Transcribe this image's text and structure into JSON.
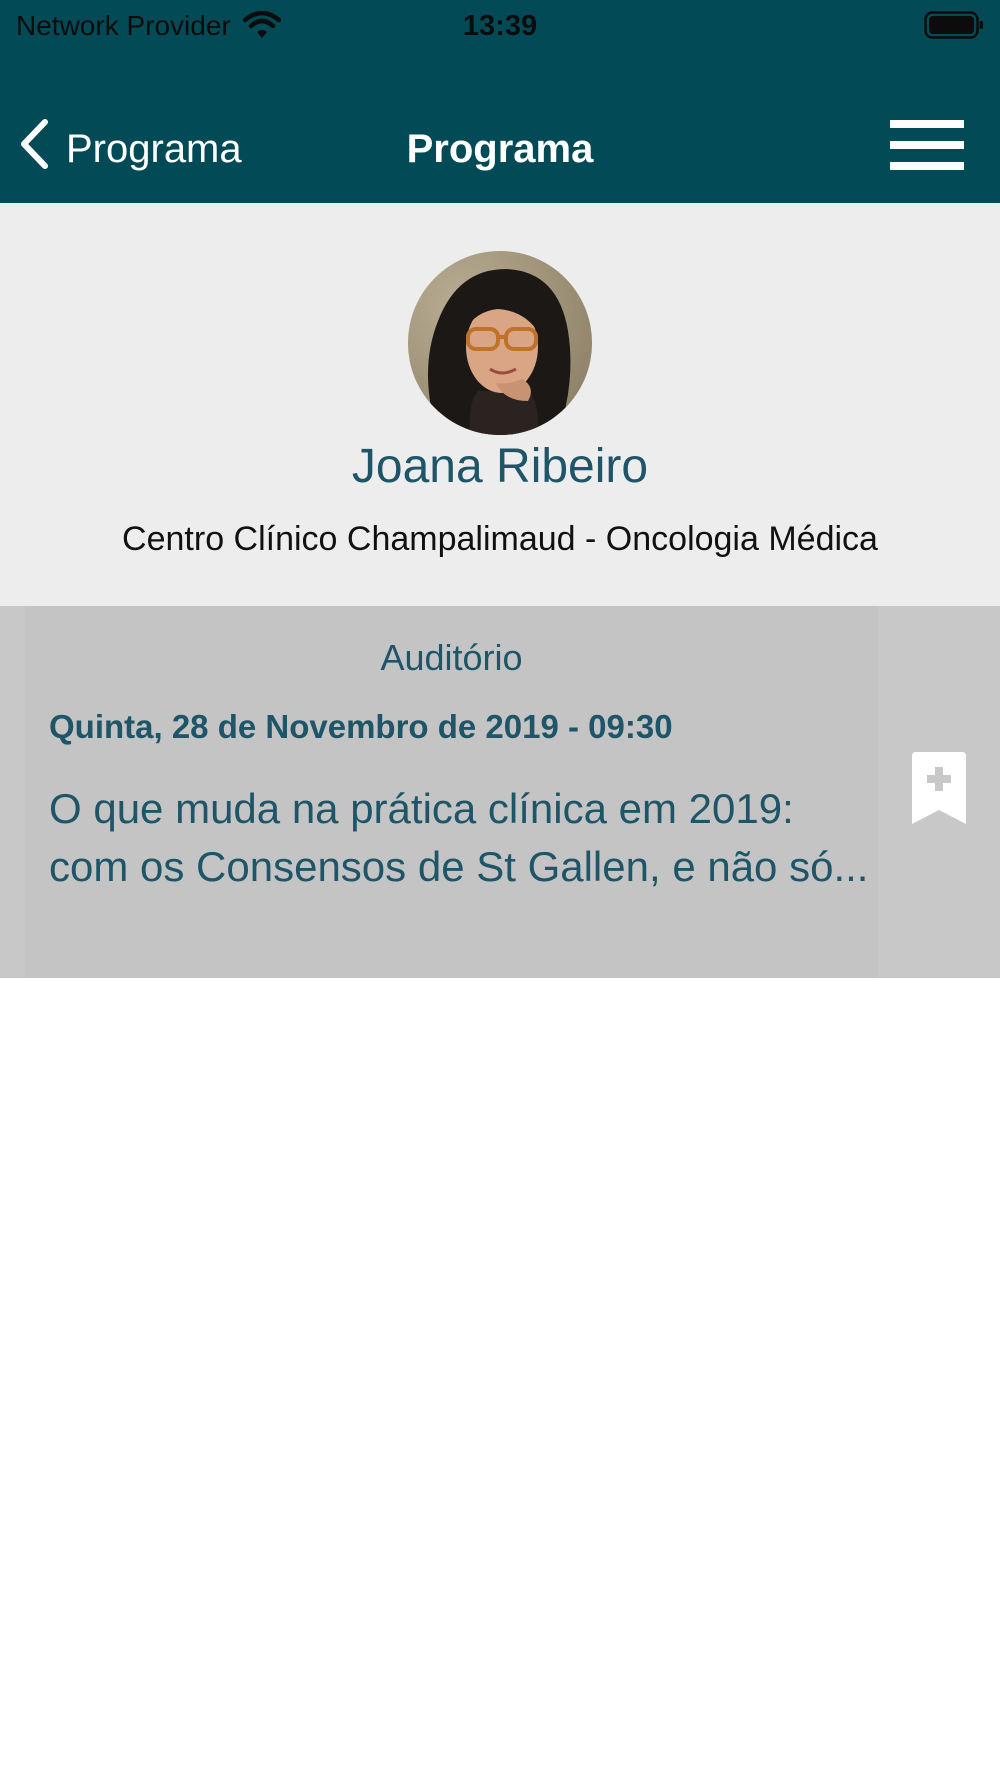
{
  "status_bar": {
    "carrier": "Network Provider",
    "time": "13:39",
    "wifi_icon": "wifi-icon",
    "battery_icon": "battery-icon"
  },
  "nav": {
    "back_label": "Programa",
    "title": "Programa",
    "menu_icon": "hamburger-menu-icon"
  },
  "speaker": {
    "name": "Joana Ribeiro",
    "affiliation": "Centro Clínico Champalimaud - Oncologia Médica"
  },
  "session": {
    "room": "Auditório",
    "datetime": "Quinta, 28 de Novembro de 2019 - 09:30",
    "title": "O que muda na prática clínica em 2019: com os Consensos de St Gallen, e não só...",
    "bookmark_icon": "bookmark-add-icon"
  },
  "colors": {
    "header": "#034a57",
    "accent_text": "#1e5568",
    "profile_bg": "#ededed",
    "session_bg": "#c8c8c8"
  }
}
